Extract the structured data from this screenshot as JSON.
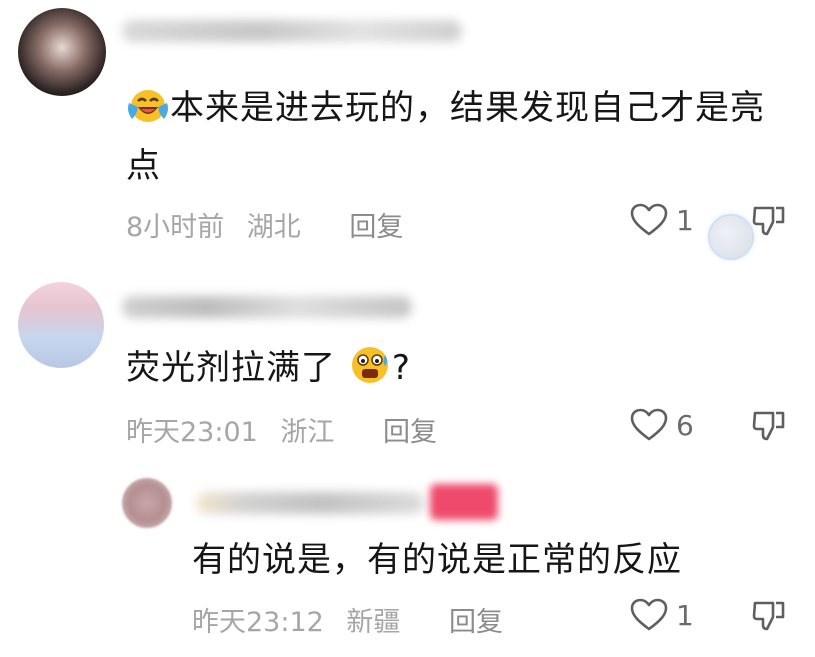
{
  "colors": {
    "text": "#161616",
    "meta": "#a6a6a6",
    "reply": "#8c8c8c",
    "icon": "#5f5f5f",
    "badge": "#ef4a6c"
  },
  "comments": [
    {
      "text_line1": "本来是进去玩的，结果发现自己才是亮",
      "text_line2": "点",
      "emoji": "laughing-crying-emoji",
      "time": "8小时前",
      "location": "湖北",
      "reply_label": "回复",
      "likes": "1"
    },
    {
      "text": "荧光剂拉满了",
      "text_suffix": "?",
      "emoji": "screaming-face-emoji",
      "time": "昨天23:01",
      "location": "浙江",
      "reply_label": "回复",
      "likes": "6"
    },
    {
      "text": "有的说是，有的说是正常的反应",
      "time": "昨天23:12",
      "location": "新疆",
      "reply_label": "回复",
      "likes": "1"
    }
  ]
}
